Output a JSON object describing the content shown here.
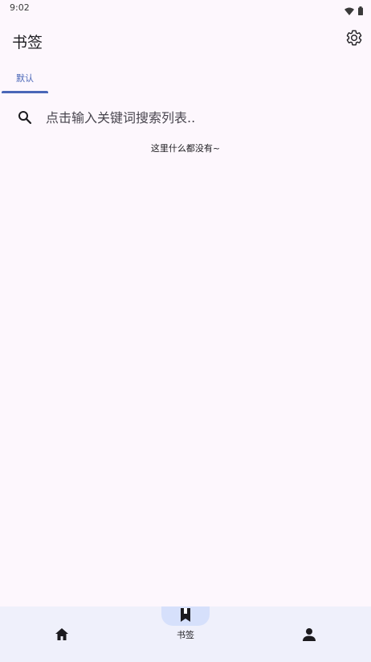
{
  "status_bar": {
    "time": "9:02",
    "icons": [
      "wifi-icon",
      "battery-icon"
    ]
  },
  "app_bar": {
    "title": "书签",
    "settings_icon": "settings-gear-icon"
  },
  "tabs": [
    {
      "label": "默认",
      "selected": true
    }
  ],
  "search": {
    "placeholder": "点击输入关键词搜索列表..",
    "value": "",
    "icon": "search-icon"
  },
  "empty_state": {
    "text": "这里什么都没有~"
  },
  "bottom_nav": {
    "items": [
      {
        "icon": "home-icon",
        "label": "",
        "selected": false
      },
      {
        "icon": "bookmark-icon",
        "label": "书签",
        "selected": true
      },
      {
        "icon": "person-icon",
        "label": "",
        "selected": false
      }
    ]
  },
  "colors": {
    "background": "#fdf7fd",
    "accent": "#4a67b8",
    "nav_background": "#eff0fb",
    "nav_indicator": "#d6e0fb"
  }
}
